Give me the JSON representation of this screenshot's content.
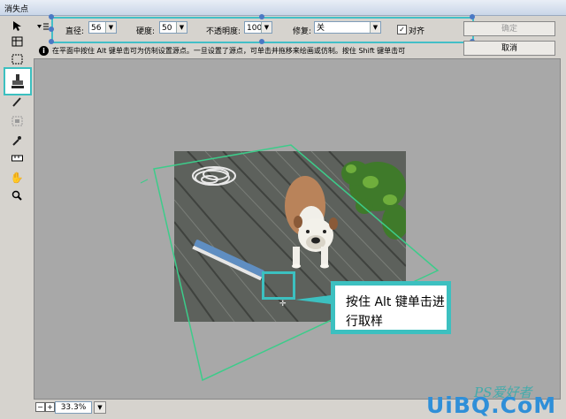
{
  "window": {
    "title": "消失点"
  },
  "options": {
    "diameter_label": "直径:",
    "diameter_value": "56",
    "hardness_label": "硬度:",
    "hardness_value": "50",
    "opacity_label": "不透明度:",
    "opacity_value": "100",
    "heal_label": "修复:",
    "heal_value": "关",
    "align_label": "对齐",
    "align_checked": "✓"
  },
  "buttons": {
    "ok": "确定",
    "cancel": "取消"
  },
  "info": {
    "text": "在平面中按住 Alt 键单击可为仿制设置源点。一旦设置了源点，可单击并拖移来绘画或仿制。按住 Shift 键单击可"
  },
  "callout": {
    "text": "按住 Alt 键单击进行取样"
  },
  "status": {
    "zoom": "33.3%"
  },
  "watermark": {
    "script": "PS爱好者",
    "site": "UiBQ.CoM"
  },
  "colors": {
    "accent": "#3cc0c0",
    "handle": "#4a78c4",
    "grid_line": "#3ccc8a"
  }
}
